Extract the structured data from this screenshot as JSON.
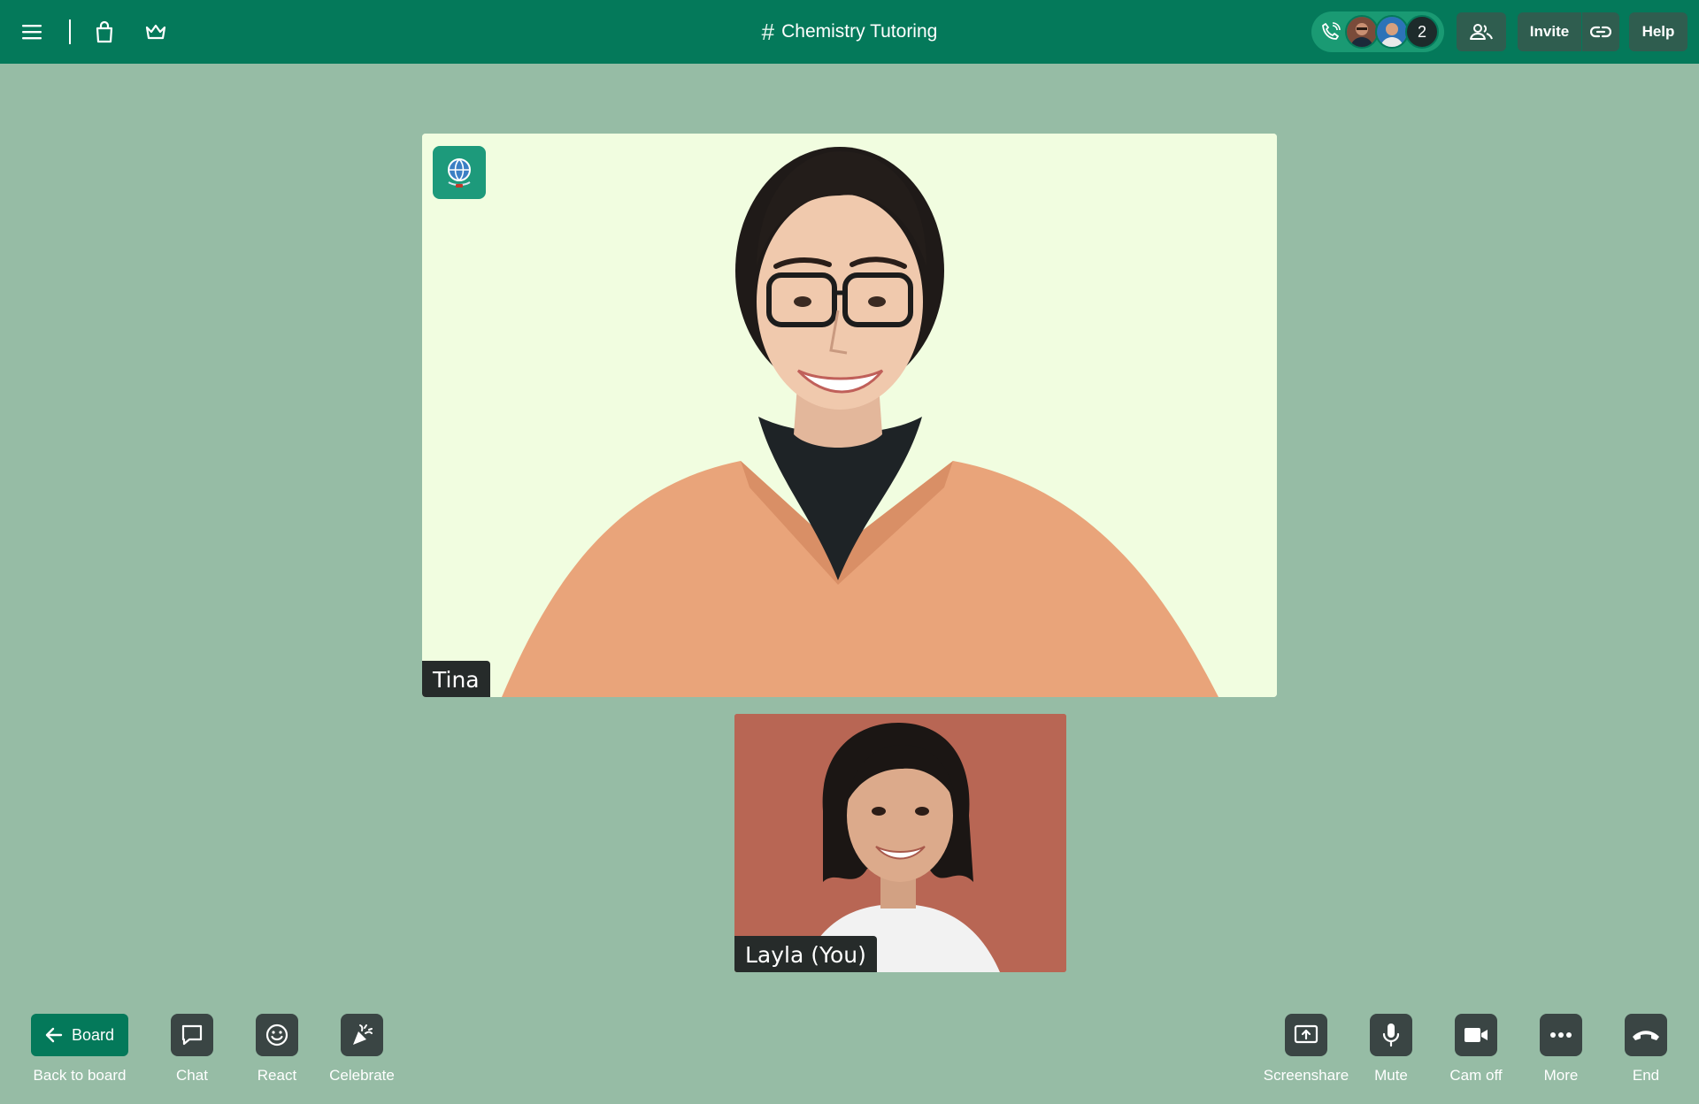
{
  "header": {
    "room_title": "Chemistry Tutoring",
    "participant_count": "2",
    "invite_label": "Invite",
    "help_label": "Help",
    "icons": [
      "menu-icon",
      "bag-icon",
      "crown-icon",
      "phone-icon",
      "people-icon",
      "link-icon"
    ]
  },
  "videos": {
    "main": {
      "name": "Tina",
      "badge_icon": "globe-icon"
    },
    "self": {
      "name": "Layla (You)"
    }
  },
  "controls": {
    "left": {
      "board_button": "Board",
      "back_to_board": "Back to board",
      "chat": "Chat",
      "react": "React",
      "celebrate": "Celebrate"
    },
    "right": {
      "screenshare": "Screenshare",
      "mute": "Mute",
      "cam_off": "Cam off",
      "more": "More",
      "end": "End"
    }
  },
  "colors": {
    "header_bg": "#04795a",
    "page_bg": "#96bca5",
    "button_bg": "#3a4544",
    "main_tile_bg": "#f1fde0",
    "self_tile_bg": "#b86654"
  }
}
